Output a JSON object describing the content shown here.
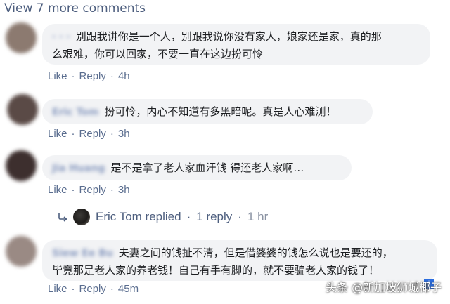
{
  "view_more": "View 7 more comments",
  "comments": [
    {
      "name": "· · ·",
      "line1": "别跟我讲你是一个人，别跟我说你没有家人，娘家还是家，真的那",
      "line2": "么艰难，你可以回家，不要一直在这边扮可怜",
      "like": "Like",
      "reply": "Reply",
      "time": "4h",
      "avatar_color": "#8c7a70"
    },
    {
      "name": "Eric Tom",
      "line1": "扮可怜，内心不知道有多黑暗呢。真是人心难测！",
      "like": "Like",
      "reply": "Reply",
      "time": "3h",
      "avatar_color": "#5a4a46"
    },
    {
      "name": "Jia Huang",
      "line1": "是不是拿了老人家血汗钱 得还老人家啊…",
      "like": "Like",
      "reply": "Reply",
      "time": "3h",
      "avatar_color": "#3d2f2e"
    },
    {
      "name": "Siew Ee Bu",
      "line1": "夫妻之间的钱扯不清，但是借婆婆的钱怎么说也是要还的，",
      "line2": "毕竟那是老人家的养老钱！自己有手有脚的，就不要骗老人家的钱了！",
      "like": "Like",
      "reply": "Reply",
      "time": "45m",
      "avatar_color": "#9a8a84"
    }
  ],
  "replied": {
    "name": "Eric Tom replied",
    "dot": "·",
    "count": "1 reply",
    "time": "1 hr"
  },
  "info_badge": "i",
  "watermark": "头条 @新加坡狮城椰子"
}
